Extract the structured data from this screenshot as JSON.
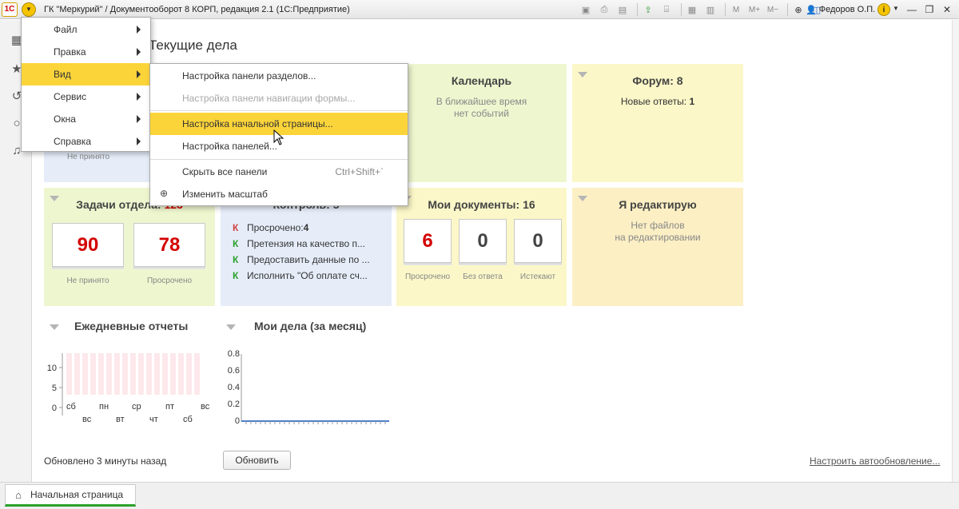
{
  "window": {
    "logo": "1С",
    "title": "ГК \"Меркурий\" / Документооборот 8 КОРП, редакция 2.1  (1С:Предприятие)",
    "user": "Федоров О.П.",
    "toolbar_icons": [
      "save-icon",
      "print-icon",
      "preview-icon",
      "attach-icon",
      "scan-icon",
      "calculator-icon",
      "calendar-icon"
    ],
    "memory_buttons": [
      "M",
      "M+",
      "M−"
    ],
    "help": "i"
  },
  "page": {
    "title": "Текущие дела",
    "status": "Обновлено 3 минуты назад",
    "refresh_label": "Обновить",
    "autoupdate_link": "Настроить автообновление..."
  },
  "tiles": {
    "top_partial_cap": "Не принято",
    "calendar": {
      "title": "Календарь",
      "sub1": "В ближайшее время",
      "sub2": "нет событий"
    },
    "forum": {
      "title": "Форум: 8",
      "sub_label": "Новые ответы: ",
      "sub_value": "1"
    },
    "dept_tasks": {
      "title": "Задачи отдела: ",
      "count": "123",
      "counters": [
        {
          "value": "90",
          "caption": "Не принято"
        },
        {
          "value": "78",
          "caption": "Просрочено"
        }
      ]
    },
    "control": {
      "title": "Контроль: 5",
      "items": [
        {
          "mark": "К",
          "color": "red",
          "text": "Просрочено: ",
          "bold": "4"
        },
        {
          "mark": "К",
          "color": "green",
          "text": "Претензия на качество п...",
          "bold": ""
        },
        {
          "mark": "К",
          "color": "green",
          "text": "Предоставить данные по ...",
          "bold": ""
        },
        {
          "mark": "К",
          "color": "green",
          "text": "Исполнить \"Об оплате сч...",
          "bold": ""
        }
      ]
    },
    "my_docs": {
      "title": "Мои документы: 16",
      "counters": [
        {
          "value": "6",
          "caption": "Просрочено"
        },
        {
          "value": "0",
          "caption": "Без ответа"
        },
        {
          "value": "0",
          "caption": "Истекают"
        }
      ]
    },
    "editing": {
      "title": "Я редактирую",
      "sub1": "Нет файлов",
      "sub2": "на редактировании"
    }
  },
  "daily_reports": {
    "title": "Ежедневные отчеты",
    "y_ticks": [
      "10",
      "5",
      "0"
    ],
    "x_top": [
      "сб",
      "пн",
      "ср",
      "пт",
      "вс"
    ],
    "x_bottom": [
      "вс",
      "вт",
      "чт",
      "сб"
    ]
  },
  "my_tasks": {
    "title": "Мои дела (за месяц)",
    "y_ticks": [
      "0.8",
      "0.6",
      "0.4",
      "0.2",
      "0"
    ]
  },
  "main_menu": {
    "items": [
      {
        "label": "Файл"
      },
      {
        "label": "Правка"
      },
      {
        "label": "Вид"
      },
      {
        "label": "Сервис"
      },
      {
        "label": "Окна"
      },
      {
        "label": "Справка"
      }
    ]
  },
  "view_submenu": {
    "items": [
      {
        "label": "Настройка панели разделов..."
      },
      {
        "label": "Настройка панели навигации формы..."
      },
      {
        "label": "Настройка начальной страницы..."
      },
      {
        "label": "Настройка панелей..."
      },
      {
        "label": "Скрыть все панели",
        "shortcut": "Ctrl+Shift+`"
      },
      {
        "label": "Изменить масштаб"
      }
    ]
  },
  "tabs": {
    "home": "Начальная страница"
  },
  "colors": {
    "accent_yellow": "#fbd43a",
    "tile_green": "#eef6cf",
    "tile_blue": "#e6edf9",
    "tile_yellow": "#fbf7c8",
    "tile_orange": "#fcefc4",
    "counter_red": "#d40000",
    "bar_pink": "#fde8ec",
    "line_blue": "#4a7fc9"
  }
}
